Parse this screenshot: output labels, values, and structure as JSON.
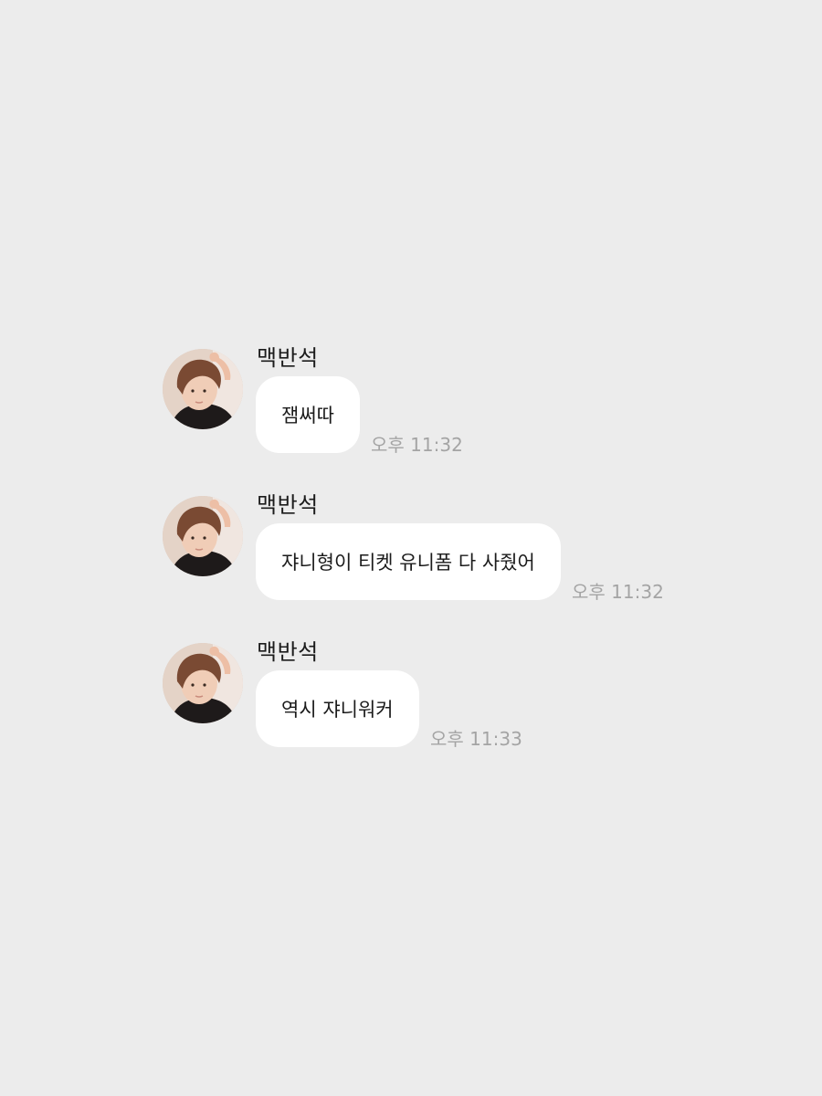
{
  "messages": [
    {
      "sender": "맥반석",
      "text": "잼써따",
      "time": "오후 11:32"
    },
    {
      "sender": "맥반석",
      "text": "쟈니형이 티켓 유니폼 다 사줬어",
      "time": "오후 11:32"
    },
    {
      "sender": "맥반석",
      "text": "역시 쟈니워커",
      "time": "오후 11:33"
    }
  ],
  "colors": {
    "background": "#ececec",
    "bubble": "#ffffff",
    "timestamp": "#a4a4a4",
    "text": "#1b1b1b"
  },
  "icons": {
    "avatar": "profile-photo"
  }
}
